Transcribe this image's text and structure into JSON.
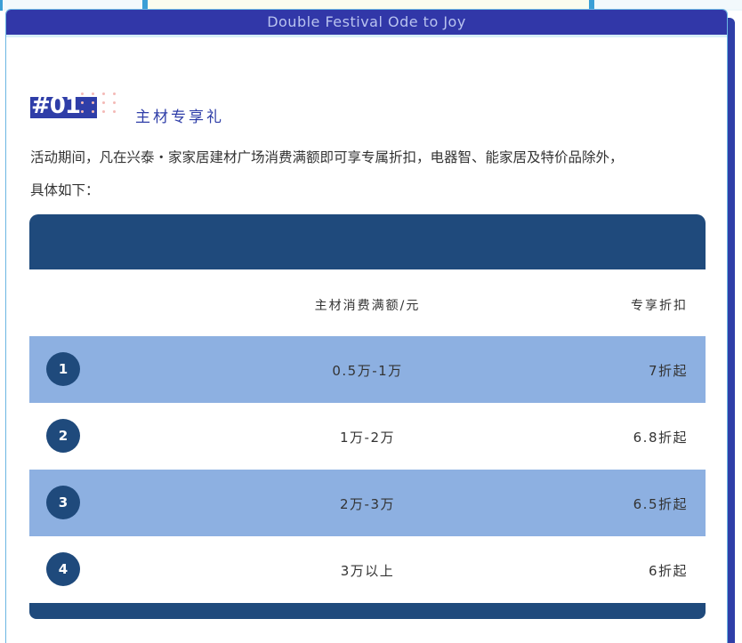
{
  "header": {
    "title": "Double Festival Ode to Joy"
  },
  "section": {
    "badge": "#01",
    "title": "主材专享礼",
    "description_line1": "活动期间，凡在兴泰・家家居建材广场消费满额即可享专属折扣，电器智、能家居及特价品除外，",
    "description_line2": "具体如下："
  },
  "table": {
    "columns": [
      "主材消费满额/元",
      "专享折扣"
    ],
    "rows": [
      {
        "index": "1",
        "amount": "0.5万-1万",
        "discount": "7折起"
      },
      {
        "index": "2",
        "amount": "1万-2万",
        "discount": "6.8折起"
      },
      {
        "index": "3",
        "amount": "2万-3万",
        "discount": "6.5折起"
      },
      {
        "index": "4",
        "amount": "3万以上",
        "discount": "6折起"
      }
    ]
  },
  "colors": {
    "header_bg": "#3137a8",
    "table_band": "#1f4a7c",
    "row_alt": "#8db0e1",
    "badge_bg": "#2f3ea8",
    "accent_dots": "#f4b9b6"
  }
}
